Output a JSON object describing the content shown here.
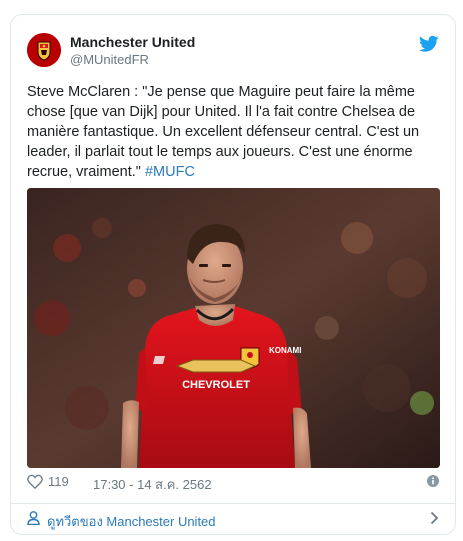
{
  "tweet": {
    "display_name": "Manchester United",
    "handle": "@MUnitedFR",
    "text": "Steve McClaren : \"Je pense que Maguire peut faire la même chose [que van Dijk] pour United. Il l'a fait contre Chelsea de manière fantastique. Un excellent défenseur central. C'est un leader, il parlait tout le temps aux joueurs. C'est une énorme recrue, vraiment.\" ",
    "hashtag": "#MUFC",
    "likes": "119",
    "timestamp": "17:30 - 14 ส.ค. 2562",
    "view_more": "ดูทวีตของ Manchester United"
  },
  "media": {
    "jersey_sponsor": "CHEVROLET",
    "sleeve_text": "KONAMI"
  },
  "colors": {
    "link": "#2b7bb9",
    "twitter_blue": "#1da1f2",
    "mu_red": "#c70101",
    "muted": "#697882"
  },
  "icons": [
    "twitter-bird-icon",
    "heart-icon",
    "info-icon",
    "person-icon",
    "chevron-right-icon"
  ]
}
